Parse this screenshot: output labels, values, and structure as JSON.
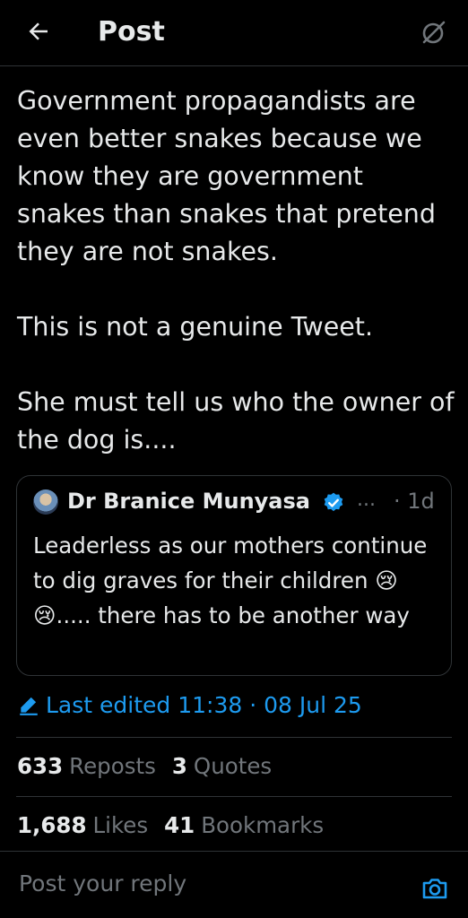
{
  "header": {
    "title": "Post",
    "back_icon": "arrow-left-icon",
    "grok_icon": "grok-icon"
  },
  "post": {
    "text": "Government propagandists are even better snakes because we know they are government snakes than snakes that pretend they are not snakes.\n\nThis is not a genuine Tweet.\n\nShe must tell us who the owner of the dog is...."
  },
  "quote": {
    "author_name": "Dr Branice Munyasa",
    "ellipsis": "...",
    "time": "· 1d",
    "text": "Leaderless as our mothers continue to dig graves for their children 😢😢..... there has to be another way",
    "verified": true
  },
  "edited": {
    "label": "Last edited 11:38 · 08 Jul 25"
  },
  "stats": {
    "reposts_count": "633",
    "reposts_label": "Reposts",
    "quotes_count": "3",
    "quotes_label": "Quotes",
    "likes_count": "1,688",
    "likes_label": "Likes",
    "bookmarks_count": "41",
    "bookmarks_label": "Bookmarks"
  },
  "reply": {
    "placeholder": "Post your reply"
  },
  "colors": {
    "background": "#000000",
    "text": "#e7e9ea",
    "muted": "#71767b",
    "accent": "#1d9bf0",
    "border": "#2f3336"
  }
}
